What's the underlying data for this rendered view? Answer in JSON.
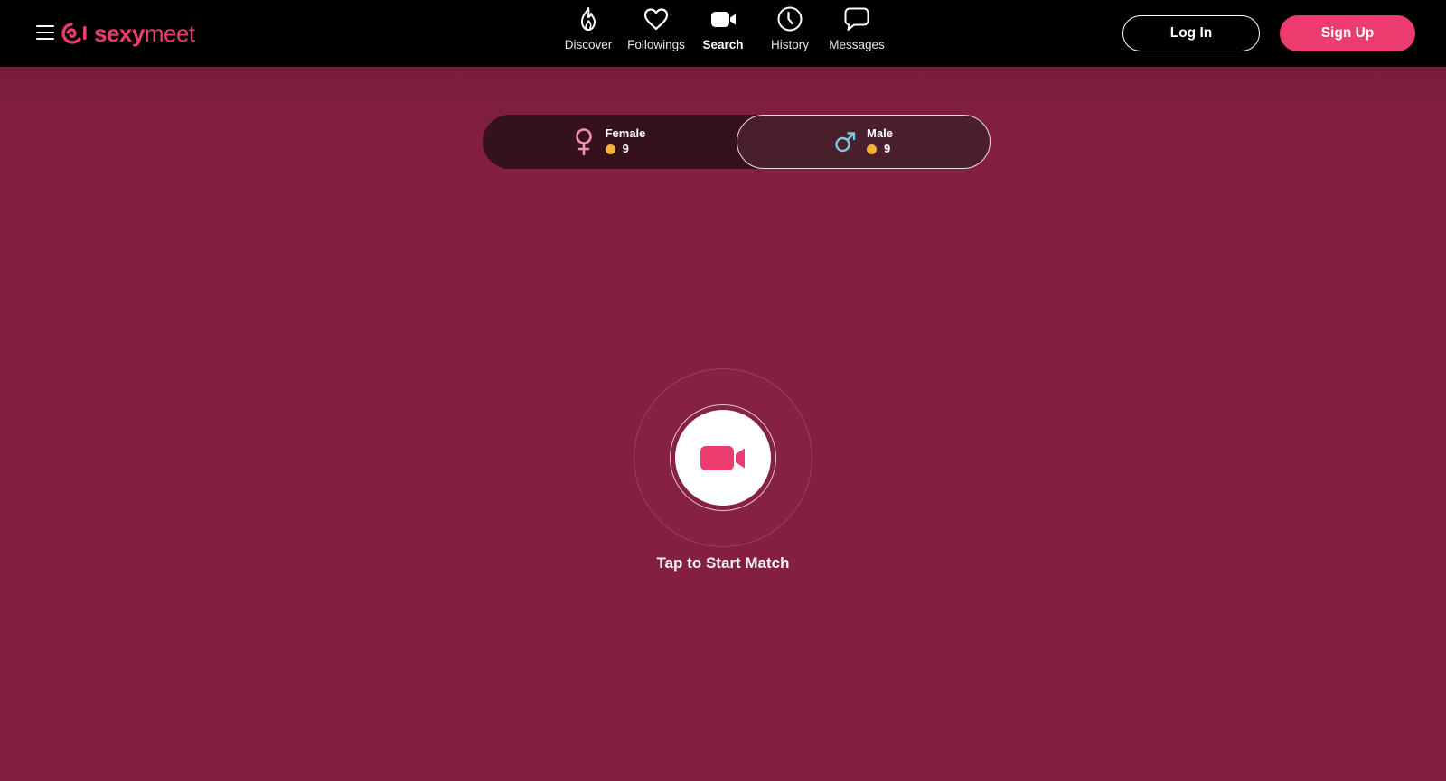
{
  "header": {
    "brand_bold": "sexy",
    "brand_regular": "meet",
    "nav": [
      {
        "label": "Discover",
        "icon": "flame-icon"
      },
      {
        "label": "Followings",
        "icon": "heart-icon"
      },
      {
        "label": "Search",
        "icon": "video-camera-icon",
        "active": true
      },
      {
        "label": "History",
        "icon": "clock-icon"
      },
      {
        "label": "Messages",
        "icon": "chat-bubble-icon"
      }
    ],
    "login_label": "Log In",
    "signup_label": "Sign Up"
  },
  "gender_selector": {
    "female": {
      "label": "Female",
      "cost": "9"
    },
    "male": {
      "label": "Male",
      "cost": "9",
      "selected": true
    }
  },
  "match": {
    "label": "Tap to Start Match"
  },
  "colors": {
    "brand": "#ec3b6f",
    "background": "#851f40",
    "topbar": "#000000",
    "coin": "#f5b23b",
    "female_symbol": "#f48fb1",
    "male_symbol": "#7fc8e0"
  }
}
